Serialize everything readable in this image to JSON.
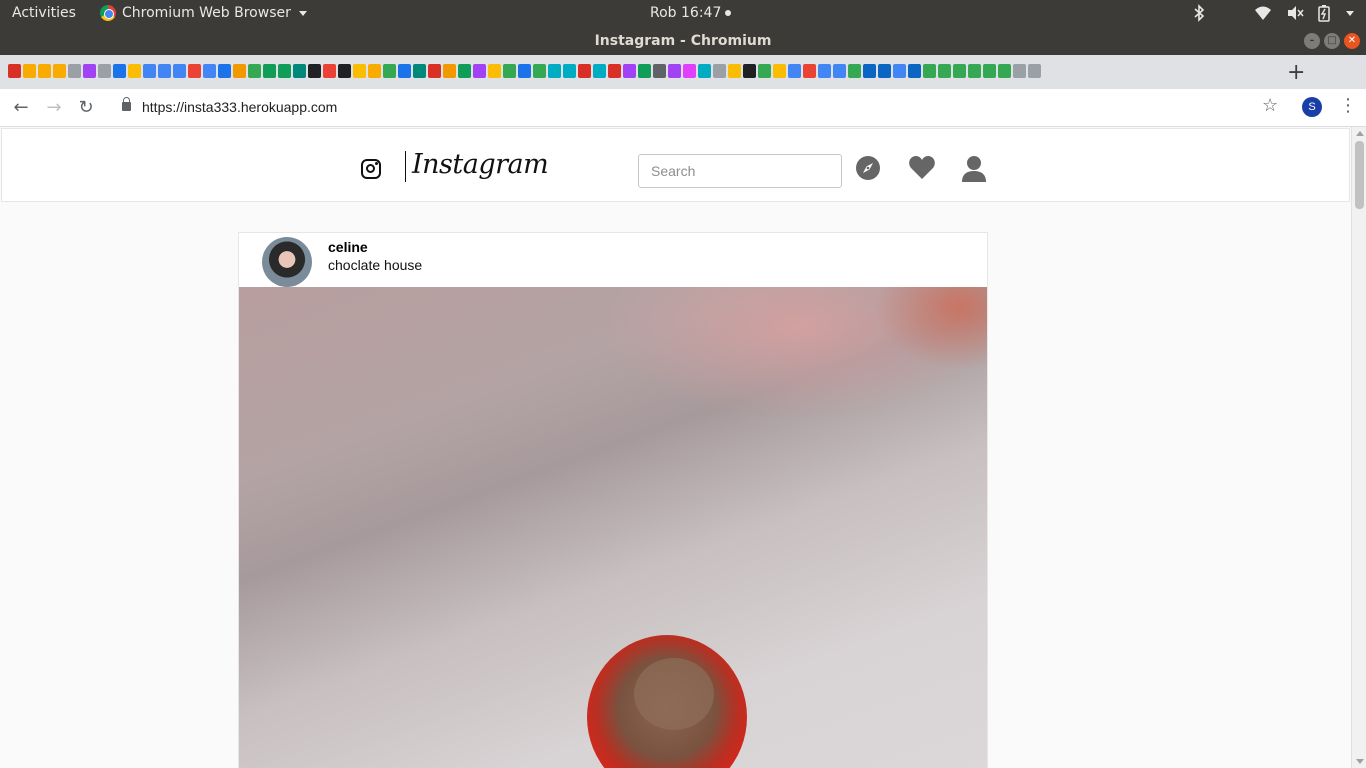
{
  "system_bar": {
    "activities": "Activities",
    "app_name": "Chromium Web Browser",
    "clock": "Rob 16:47"
  },
  "window": {
    "title": "Instagram - Chromium"
  },
  "browser": {
    "url": "https://insta333.herokuapp.com",
    "profile_initial": "S",
    "new_tab_label": "+",
    "bookmark_favicon_colors": [
      "#d93025",
      "#f9ab00",
      "#f9ab00",
      "#f9ab00",
      "#9aa0a6",
      "#a142f4",
      "#9aa0a6",
      "#1a73e8",
      "#fbbc04",
      "#4285f4",
      "#4285f4",
      "#4285f4",
      "#ea4335",
      "#4285f4",
      "#1a73e8",
      "#f29900",
      "#34a853",
      "#0f9d58",
      "#0f9d58",
      "#00897b",
      "#202124",
      "#ea4335",
      "#202124",
      "#fbbc04",
      "#f9ab00",
      "#34a853",
      "#1a73e8",
      "#00897b",
      "#d93025",
      "#f29900",
      "#0f9d58",
      "#a142f4",
      "#fbbc04",
      "#34a853",
      "#1a73e8",
      "#34a853",
      "#00acc1",
      "#00acc1",
      "#d93025",
      "#00acc1",
      "#d93025",
      "#a142f4",
      "#0f9d58",
      "#5f6368",
      "#a142f4",
      "#e040fb",
      "#00acc1",
      "#9aa0a6",
      "#fbbc04",
      "#202124",
      "#34a853",
      "#fbbc04",
      "#4285f4",
      "#ea4335",
      "#4285f4",
      "#4285f4",
      "#34a853",
      "#0a66c2",
      "#0a66c2",
      "#4285f4",
      "#0a66c2",
      "#34a853",
      "#34a853",
      "#34a853",
      "#34a853",
      "#34a853",
      "#34a853",
      "#9aa0a6",
      "#9aa0a6"
    ]
  },
  "instagram": {
    "wordmark": "Instagram",
    "search_placeholder": "Search",
    "icons": [
      "compass-icon",
      "heart-icon",
      "user-icon"
    ]
  },
  "post": {
    "username": "celine",
    "caption": "choclate house"
  }
}
